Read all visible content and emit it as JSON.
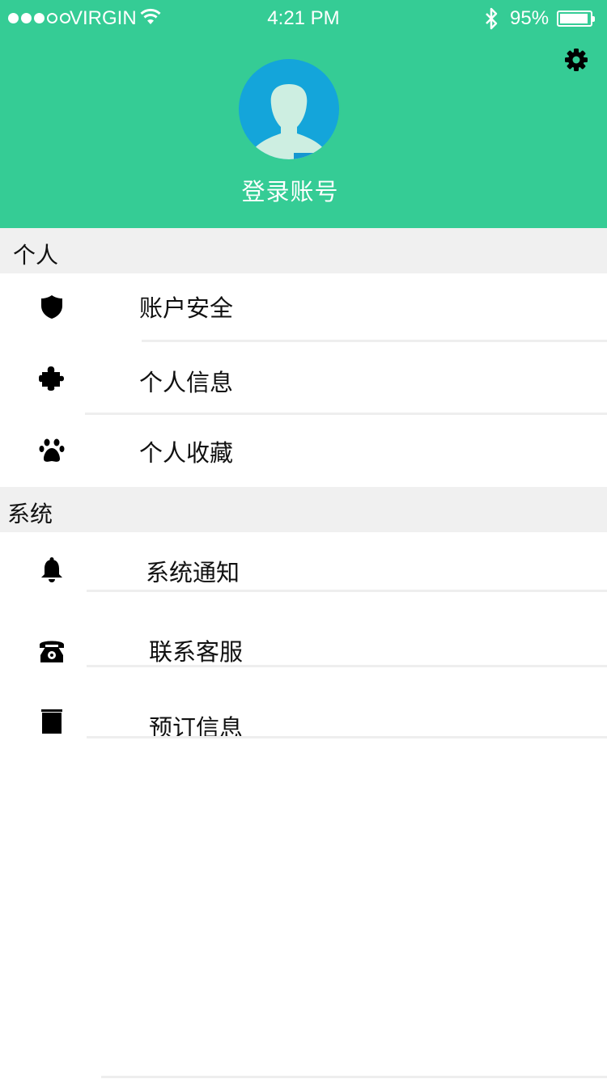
{
  "status_bar": {
    "carrier": "VIRGIN",
    "time": "4:21 PM",
    "battery_percent": "95%",
    "battery_level": 0.95,
    "signal_bars_filled": 3,
    "signal_bars_total": 5
  },
  "header": {
    "background_color": "#35cc95",
    "login_label": "登录账号",
    "avatar_color": "#14a5da",
    "settings_icon": "gear-icon"
  },
  "personal": {
    "title": "个人",
    "items": [
      {
        "label": "账户安全",
        "icon": "shield-icon"
      },
      {
        "label": "个人信息",
        "icon": "puzzle-icon"
      },
      {
        "label": "个人收藏",
        "icon": "paw-icon"
      }
    ]
  },
  "system": {
    "title": "系统",
    "items": [
      {
        "label": "系统通知",
        "icon": "bell-icon"
      },
      {
        "label": "联系客服",
        "icon": "phone-icon"
      },
      {
        "label": "预订信息",
        "icon": "book-icon"
      }
    ]
  }
}
